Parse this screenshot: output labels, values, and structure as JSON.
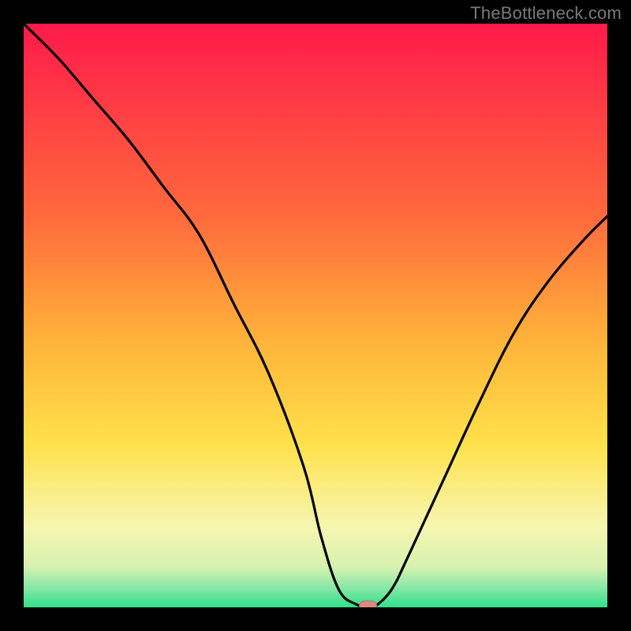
{
  "watermark": "TheBottleneck.com",
  "colors": {
    "background": "#000000",
    "watermark": "#7a7a7a",
    "curve": "#000000",
    "marker_fill": "#d98880",
    "marker_stroke": "#c06a60",
    "gradient_top": "#ff1a4a",
    "gradient_mid": "#ffd233",
    "gradient_low": "#f7f6b0",
    "gradient_green": "#2ee08a"
  },
  "chart_data": {
    "type": "line",
    "title": "",
    "xlabel": "",
    "ylabel": "",
    "xlim": [
      0,
      100
    ],
    "ylim": [
      0,
      100
    ],
    "x": [
      0,
      6,
      12,
      18,
      24,
      30,
      36,
      42,
      48,
      51,
      54,
      57,
      59,
      60,
      63,
      66,
      72,
      78,
      84,
      90,
      96,
      100
    ],
    "values": [
      100,
      94,
      87,
      80,
      72,
      64,
      52,
      40,
      24,
      12,
      3,
      0.5,
      0,
      0,
      3,
      9,
      22,
      35,
      47,
      56,
      63,
      67
    ],
    "marker": {
      "x": 59,
      "y": 0
    },
    "gradient_bands": [
      {
        "y0": 0,
        "y1": 70,
        "from": "#ff1a4a",
        "to": "#ffd233"
      },
      {
        "y0": 70,
        "y1": 90,
        "from": "#ffd233",
        "to": "#f7f6b0"
      },
      {
        "y0": 90,
        "y1": 97,
        "from": "#f7f6b0",
        "to": "#b6f0c0"
      },
      {
        "y0": 97,
        "y1": 100,
        "from": "#2ee08a",
        "to": "#2ee08a"
      }
    ]
  }
}
